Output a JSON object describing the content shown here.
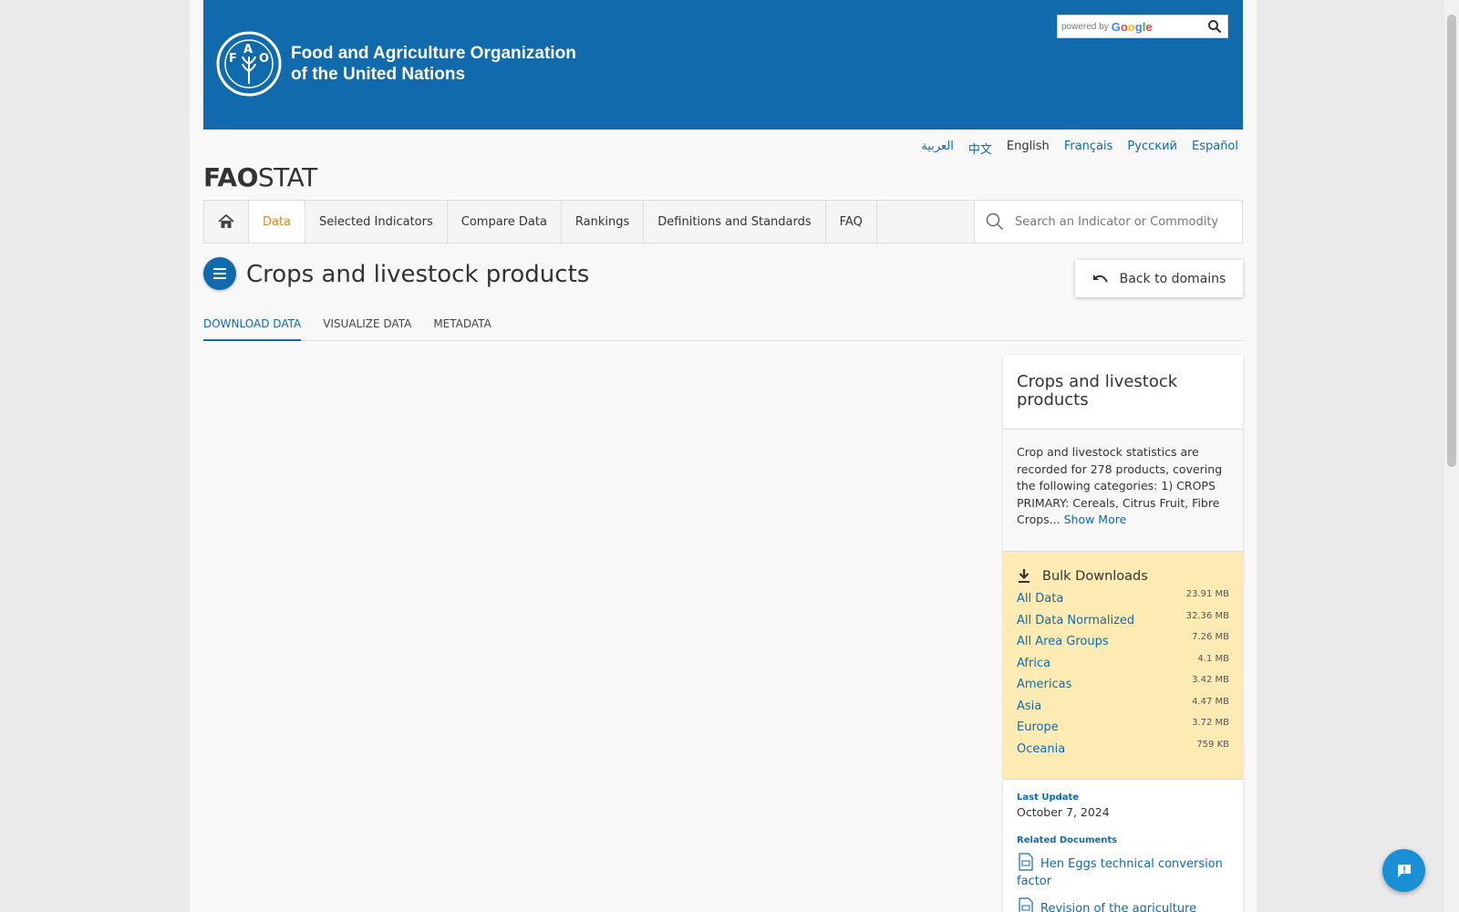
{
  "header": {
    "org_line1": "Food and Agriculture Organization",
    "org_line2": "of the United Nations",
    "search_powered": "powered by",
    "search_brand": "Google"
  },
  "languages": [
    {
      "label": "العربية",
      "active": false
    },
    {
      "label": "中文",
      "active": false
    },
    {
      "label": "English",
      "active": true
    },
    {
      "label": "Français",
      "active": false
    },
    {
      "label": "Русский",
      "active": false
    },
    {
      "label": "Español",
      "active": false
    }
  ],
  "brand": {
    "bold": "FAO",
    "light": "STAT"
  },
  "nav": {
    "items": [
      "Data",
      "Selected Indicators",
      "Compare Data",
      "Rankings",
      "Definitions and Standards",
      "FAQ"
    ],
    "active": "Data",
    "search_placeholder": "Search an Indicator or Commodity"
  },
  "page": {
    "title": "Crops and livestock products",
    "back_label": "Back to domains"
  },
  "tabs": [
    {
      "label": "DOWNLOAD DATA",
      "active": true
    },
    {
      "label": "VISUALIZE DATA",
      "active": false
    },
    {
      "label": "METADATA",
      "active": false
    }
  ],
  "side": {
    "title": "Crops and livestock products",
    "description": "Crop and livestock statistics are recorded for 278 products, covering the following categories: 1) CROPS PRIMARY: Cereals, Citrus Fruit, Fibre Crops...",
    "show_more": "Show More",
    "bulk_title": "Bulk Downloads",
    "bulk": [
      {
        "label": "All Data",
        "size": "23.91 MB"
      },
      {
        "label": "All Data Normalized",
        "size": "32.36 MB"
      },
      {
        "label": "All Area Groups",
        "size": "7.26 MB"
      },
      {
        "label": "Africa",
        "size": "4.1 MB"
      },
      {
        "label": "Americas",
        "size": "3.42 MB"
      },
      {
        "label": "Asia",
        "size": "4.47 MB"
      },
      {
        "label": "Europe",
        "size": "3.72 MB"
      },
      {
        "label": "Oceania",
        "size": "759 KB"
      }
    ],
    "last_update_label": "Last Update",
    "last_update": "October 7, 2024",
    "related_label": "Related Documents",
    "docs": [
      "Hen Eggs technical conversion factor",
      "Revision of the agriculture"
    ]
  },
  "colors": {
    "primary": "#116aab",
    "active_nav": "#e08a10",
    "bulk_bg": "#fdebb3",
    "fab": "#1a8fd6"
  }
}
